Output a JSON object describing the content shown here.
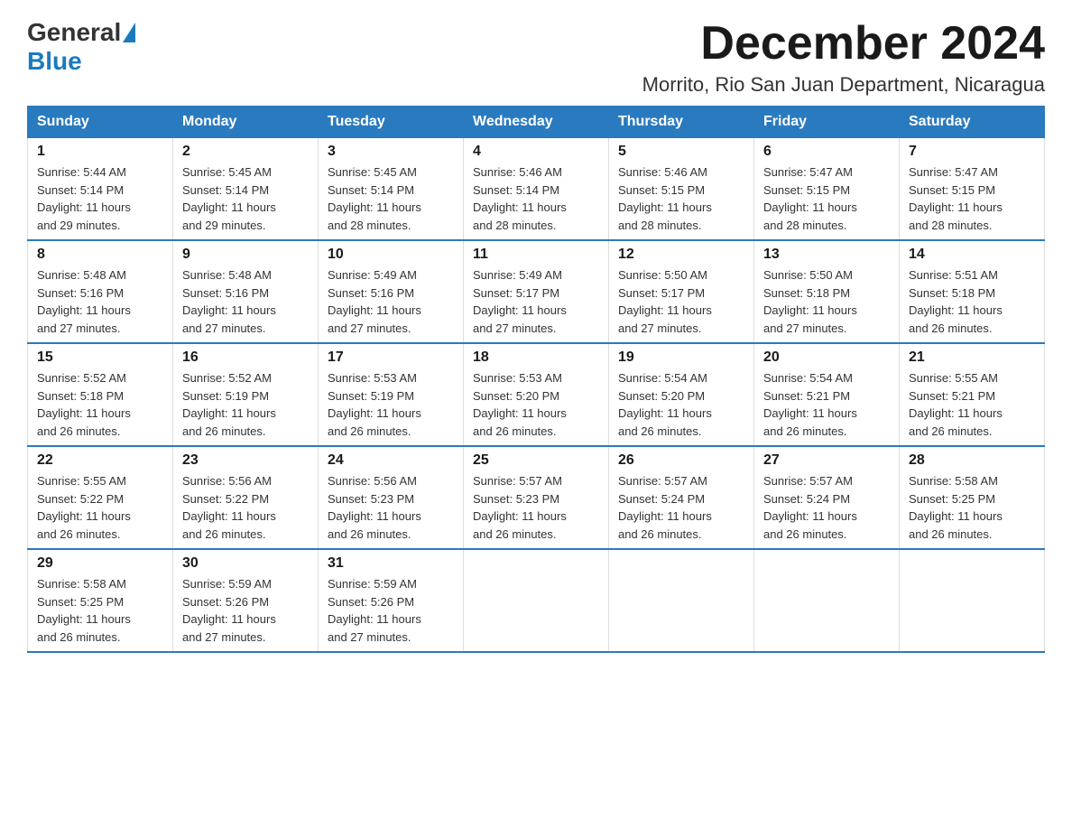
{
  "logo": {
    "general": "General",
    "blue": "Blue"
  },
  "header": {
    "month": "December 2024",
    "location": "Morrito, Rio San Juan Department, Nicaragua"
  },
  "weekdays": [
    "Sunday",
    "Monday",
    "Tuesday",
    "Wednesday",
    "Thursday",
    "Friday",
    "Saturday"
  ],
  "weeks": [
    [
      {
        "day": "1",
        "sunrise": "5:44 AM",
        "sunset": "5:14 PM",
        "daylight": "11 hours and 29 minutes."
      },
      {
        "day": "2",
        "sunrise": "5:45 AM",
        "sunset": "5:14 PM",
        "daylight": "11 hours and 29 minutes."
      },
      {
        "day": "3",
        "sunrise": "5:45 AM",
        "sunset": "5:14 PM",
        "daylight": "11 hours and 28 minutes."
      },
      {
        "day": "4",
        "sunrise": "5:46 AM",
        "sunset": "5:14 PM",
        "daylight": "11 hours and 28 minutes."
      },
      {
        "day": "5",
        "sunrise": "5:46 AM",
        "sunset": "5:15 PM",
        "daylight": "11 hours and 28 minutes."
      },
      {
        "day": "6",
        "sunrise": "5:47 AM",
        "sunset": "5:15 PM",
        "daylight": "11 hours and 28 minutes."
      },
      {
        "day": "7",
        "sunrise": "5:47 AM",
        "sunset": "5:15 PM",
        "daylight": "11 hours and 28 minutes."
      }
    ],
    [
      {
        "day": "8",
        "sunrise": "5:48 AM",
        "sunset": "5:16 PM",
        "daylight": "11 hours and 27 minutes."
      },
      {
        "day": "9",
        "sunrise": "5:48 AM",
        "sunset": "5:16 PM",
        "daylight": "11 hours and 27 minutes."
      },
      {
        "day": "10",
        "sunrise": "5:49 AM",
        "sunset": "5:16 PM",
        "daylight": "11 hours and 27 minutes."
      },
      {
        "day": "11",
        "sunrise": "5:49 AM",
        "sunset": "5:17 PM",
        "daylight": "11 hours and 27 minutes."
      },
      {
        "day": "12",
        "sunrise": "5:50 AM",
        "sunset": "5:17 PM",
        "daylight": "11 hours and 27 minutes."
      },
      {
        "day": "13",
        "sunrise": "5:50 AM",
        "sunset": "5:18 PM",
        "daylight": "11 hours and 27 minutes."
      },
      {
        "day": "14",
        "sunrise": "5:51 AM",
        "sunset": "5:18 PM",
        "daylight": "11 hours and 26 minutes."
      }
    ],
    [
      {
        "day": "15",
        "sunrise": "5:52 AM",
        "sunset": "5:18 PM",
        "daylight": "11 hours and 26 minutes."
      },
      {
        "day": "16",
        "sunrise": "5:52 AM",
        "sunset": "5:19 PM",
        "daylight": "11 hours and 26 minutes."
      },
      {
        "day": "17",
        "sunrise": "5:53 AM",
        "sunset": "5:19 PM",
        "daylight": "11 hours and 26 minutes."
      },
      {
        "day": "18",
        "sunrise": "5:53 AM",
        "sunset": "5:20 PM",
        "daylight": "11 hours and 26 minutes."
      },
      {
        "day": "19",
        "sunrise": "5:54 AM",
        "sunset": "5:20 PM",
        "daylight": "11 hours and 26 minutes."
      },
      {
        "day": "20",
        "sunrise": "5:54 AM",
        "sunset": "5:21 PM",
        "daylight": "11 hours and 26 minutes."
      },
      {
        "day": "21",
        "sunrise": "5:55 AM",
        "sunset": "5:21 PM",
        "daylight": "11 hours and 26 minutes."
      }
    ],
    [
      {
        "day": "22",
        "sunrise": "5:55 AM",
        "sunset": "5:22 PM",
        "daylight": "11 hours and 26 minutes."
      },
      {
        "day": "23",
        "sunrise": "5:56 AM",
        "sunset": "5:22 PM",
        "daylight": "11 hours and 26 minutes."
      },
      {
        "day": "24",
        "sunrise": "5:56 AM",
        "sunset": "5:23 PM",
        "daylight": "11 hours and 26 minutes."
      },
      {
        "day": "25",
        "sunrise": "5:57 AM",
        "sunset": "5:23 PM",
        "daylight": "11 hours and 26 minutes."
      },
      {
        "day": "26",
        "sunrise": "5:57 AM",
        "sunset": "5:24 PM",
        "daylight": "11 hours and 26 minutes."
      },
      {
        "day": "27",
        "sunrise": "5:57 AM",
        "sunset": "5:24 PM",
        "daylight": "11 hours and 26 minutes."
      },
      {
        "day": "28",
        "sunrise": "5:58 AM",
        "sunset": "5:25 PM",
        "daylight": "11 hours and 26 minutes."
      }
    ],
    [
      {
        "day": "29",
        "sunrise": "5:58 AM",
        "sunset": "5:25 PM",
        "daylight": "11 hours and 26 minutes."
      },
      {
        "day": "30",
        "sunrise": "5:59 AM",
        "sunset": "5:26 PM",
        "daylight": "11 hours and 27 minutes."
      },
      {
        "day": "31",
        "sunrise": "5:59 AM",
        "sunset": "5:26 PM",
        "daylight": "11 hours and 27 minutes."
      },
      null,
      null,
      null,
      null
    ]
  ],
  "labels": {
    "sunrise": "Sunrise:",
    "sunset": "Sunset:",
    "daylight": "Daylight:"
  }
}
